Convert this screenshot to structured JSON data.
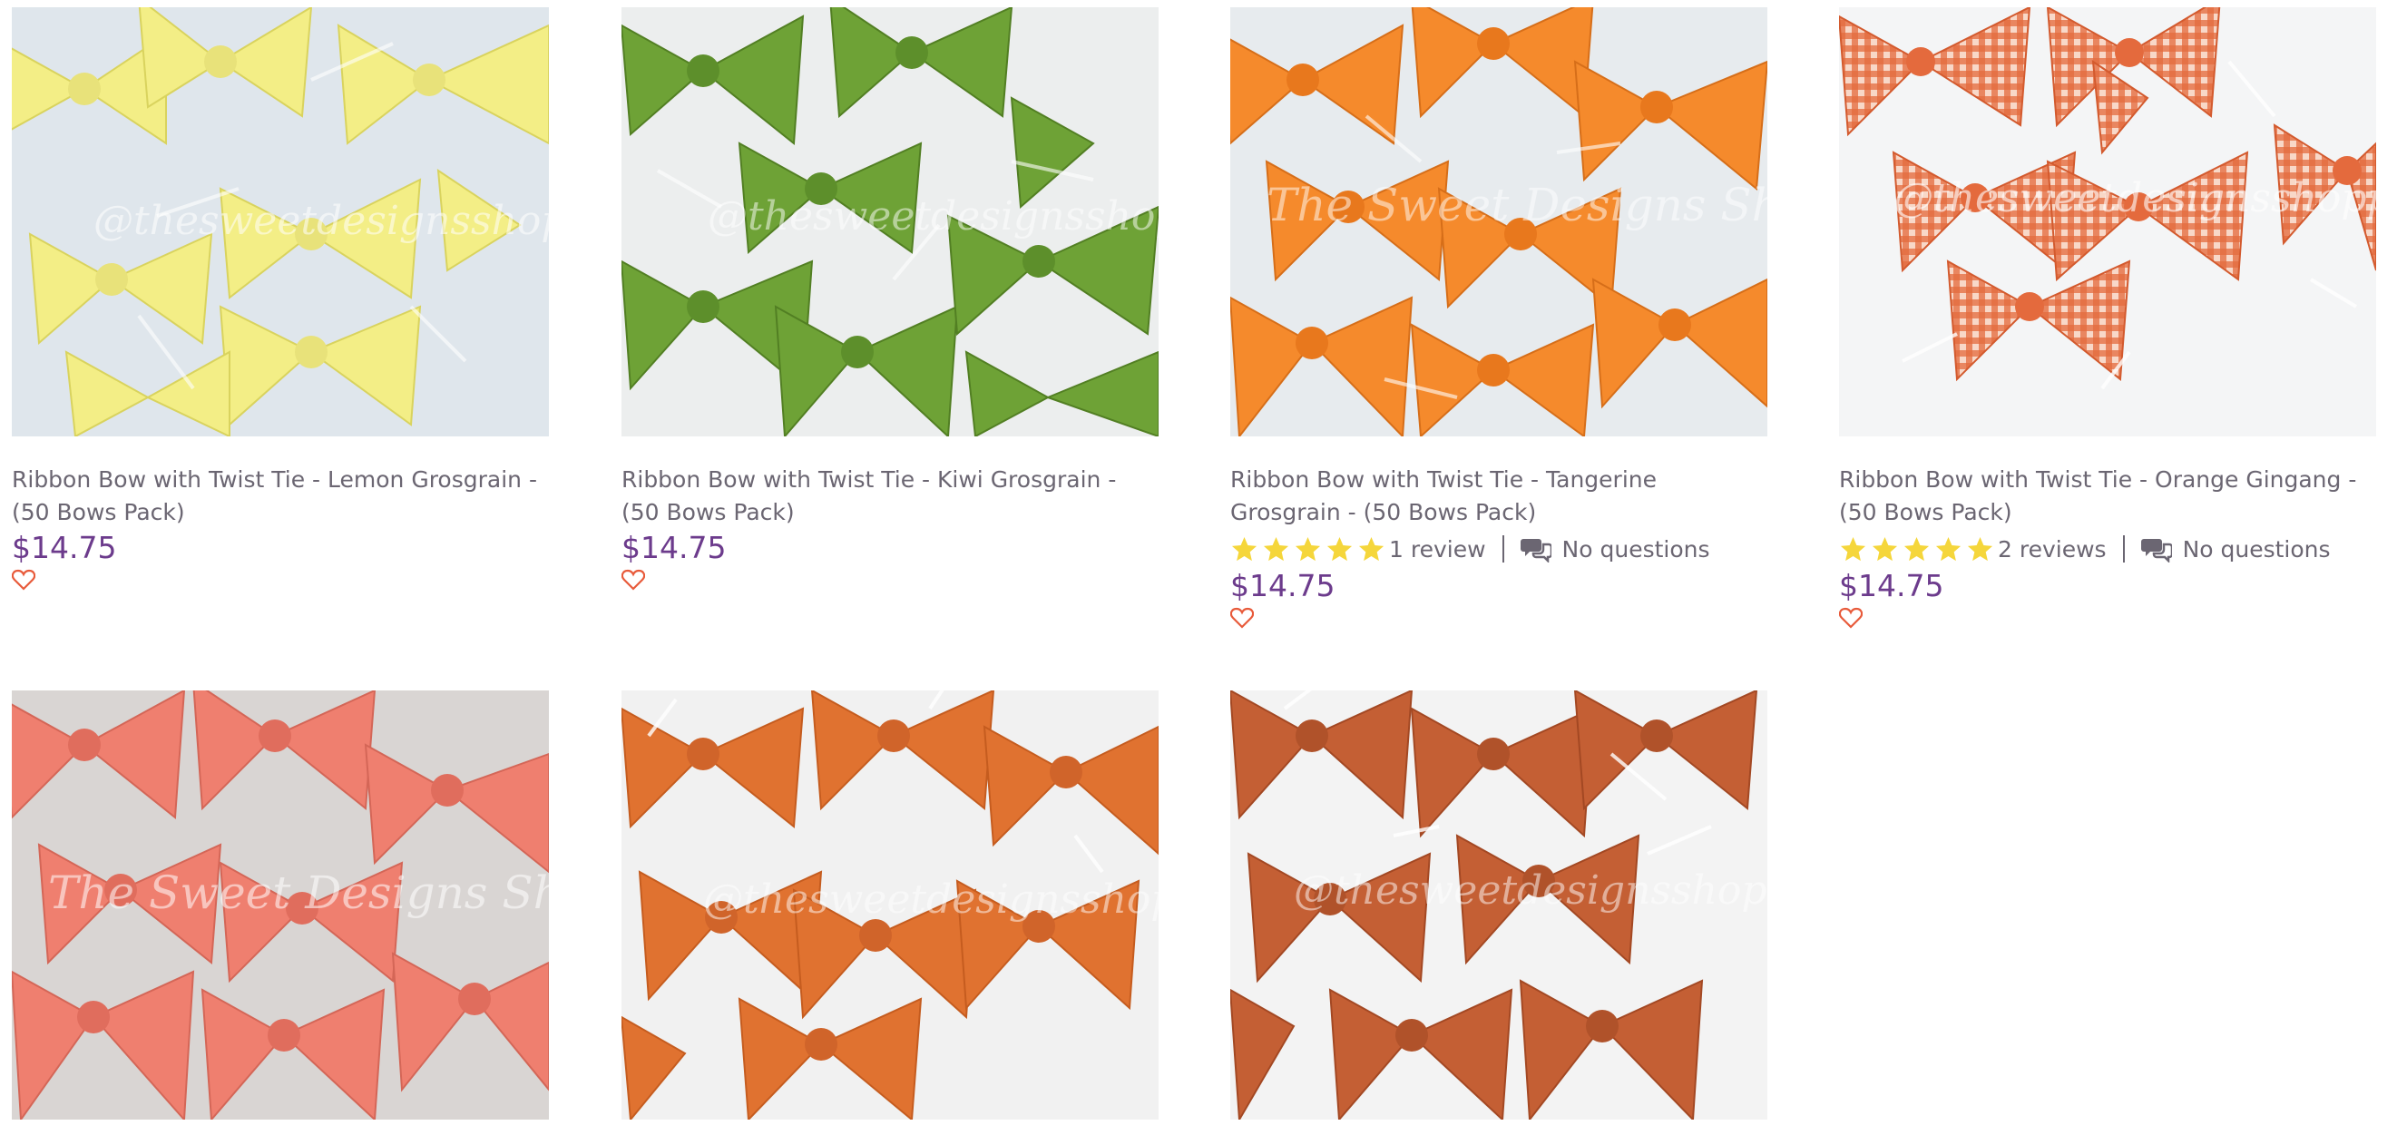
{
  "products": [
    {
      "title": "Ribbon Bow with Twist Tie - Lemon Grosgrain - (50 Bows Pack)",
      "price": "$14.75",
      "image": {
        "bg": "#dfe6ec",
        "ribbon": "#f3ee86",
        "ribbon_dark": "#d9d35e",
        "watermark": "@thesweetdesignsshoppe"
      },
      "rating": null
    },
    {
      "title": "Ribbon Bow with Twist Tie - Kiwi Grosgrain - (50 Bows Pack)",
      "price": "$14.75",
      "image": {
        "bg": "#eceeee",
        "ribbon": "#6ea236",
        "ribbon_dark": "#527f23",
        "watermark": "@thesweetdesignsshoppe"
      },
      "rating": null
    },
    {
      "title": "Ribbon Bow with Twist Tie - Tangerine Grosgrain - (50 Bows Pack)",
      "price": "$14.75",
      "image": {
        "bg": "#e7ebee",
        "ribbon": "#f58a2c",
        "ribbon_dark": "#d66e19",
        "watermark": "The Sweet Designs Shoppe"
      },
      "rating": {
        "stars": 5,
        "review_text": "1 review",
        "questions_text": "No questions"
      }
    },
    {
      "title": "Ribbon Bow with Twist Tie - Orange Gingang - (50 Bows Pack)",
      "price": "$14.75",
      "image": {
        "bg": "#f4f5f6",
        "ribbon": "#e46a3d",
        "ribbon_dark": "#f8d8c8",
        "watermark": "@thesweetdesignsshoppe"
      },
      "rating": {
        "stars": 5,
        "review_text": "2 reviews",
        "questions_text": "No questions"
      }
    },
    {
      "title": "",
      "price": "",
      "image": {
        "bg": "#d9d5d3",
        "ribbon": "#ef7f6f",
        "ribbon_dark": "#d46657",
        "watermark": "The Sweet Designs Shoppe"
      },
      "rating": null
    },
    {
      "title": "",
      "price": "",
      "image": {
        "bg": "#f1f1f1",
        "ribbon": "#e07230",
        "ribbon_dark": "#c55c1f",
        "watermark": "@thesweetdesignsshoppe"
      },
      "rating": null
    },
    {
      "title": "",
      "price": "",
      "image": {
        "bg": "#f3f3f3",
        "ribbon": "#c45f34",
        "ribbon_dark": "#a34823",
        "watermark": "@thesweetdesignsshoppe"
      },
      "rating": null
    }
  ],
  "colors": {
    "price": "#6c3b8c",
    "star": "#f5d63b",
    "heart": "#e85a3a",
    "text": "#6b6672"
  },
  "icons": {
    "star": "star-icon",
    "question": "speech-bubbles-icon",
    "favorite": "heart-icon"
  }
}
